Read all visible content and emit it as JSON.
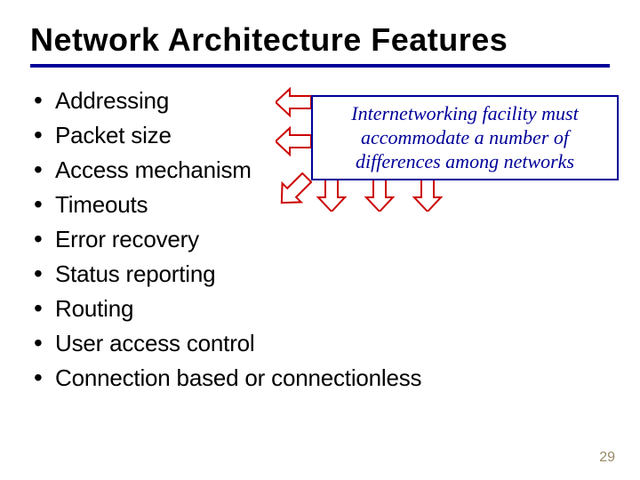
{
  "title": "Network Architecture Features",
  "bullets": [
    "Addressing",
    "Packet size",
    "Access mechanism",
    "Timeouts",
    "Error recovery",
    "Status reporting",
    "Routing",
    "User access control",
    "Connection based or connectionless"
  ],
  "callout": "Internetworking facility must accommodate a number of differences among networks",
  "page_number": "29",
  "colors": {
    "accent": "#000099",
    "arrow_stroke": "#cc0000"
  }
}
